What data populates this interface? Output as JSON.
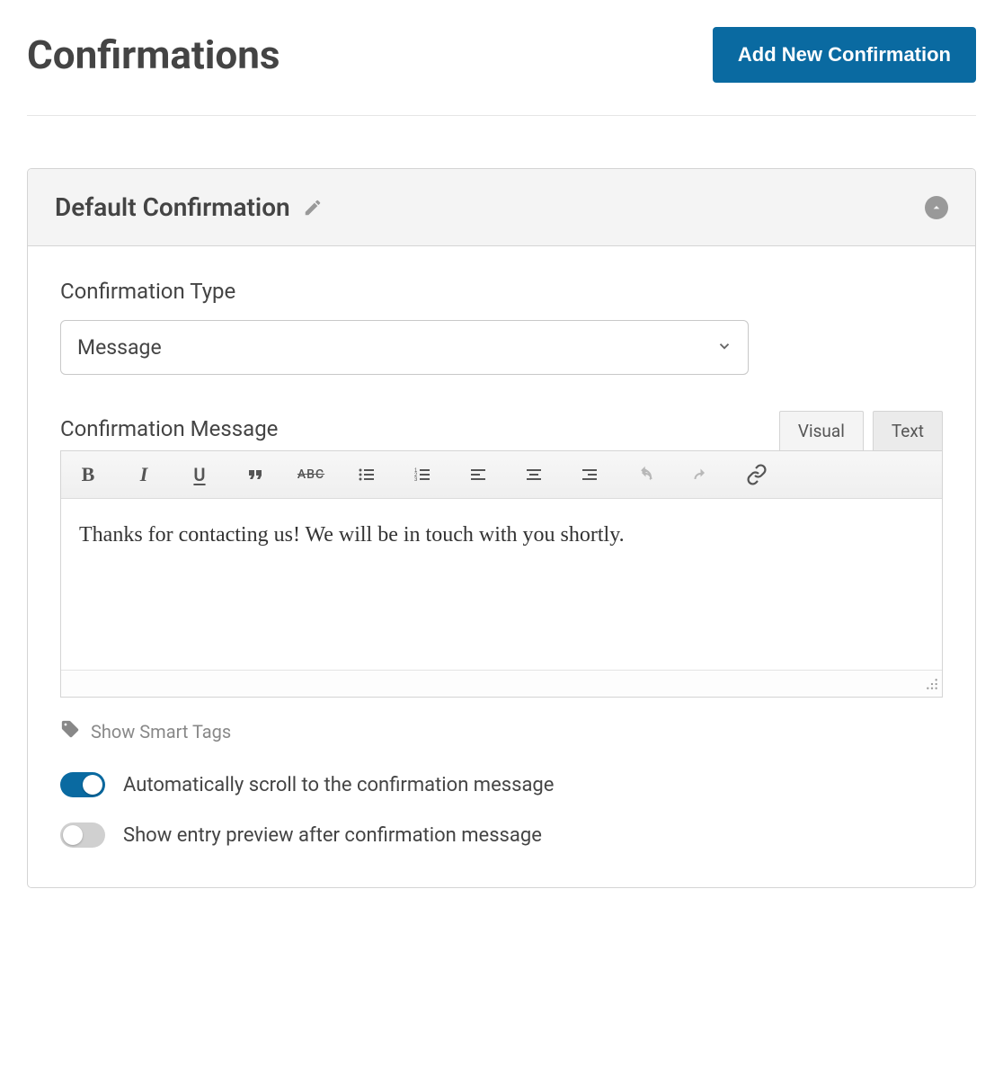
{
  "header": {
    "title": "Confirmations",
    "add_button": "Add New Confirmation"
  },
  "panel": {
    "title": "Default Confirmation"
  },
  "fields": {
    "type_label": "Confirmation Type",
    "type_value": "Message",
    "message_label": "Confirmation Message",
    "message_value": "Thanks for contacting us! We will be in touch with you shortly."
  },
  "editor": {
    "tab_visual": "Visual",
    "tab_text": "Text",
    "btn_bold": "B",
    "btn_italic": "I",
    "btn_underline": "U",
    "btn_strike": "ABC"
  },
  "smart_tags": {
    "label": "Show Smart Tags"
  },
  "toggles": {
    "scroll": {
      "label": "Automatically scroll to the confirmation message",
      "on": true
    },
    "preview": {
      "label": "Show entry preview after confirmation message",
      "on": false
    }
  }
}
